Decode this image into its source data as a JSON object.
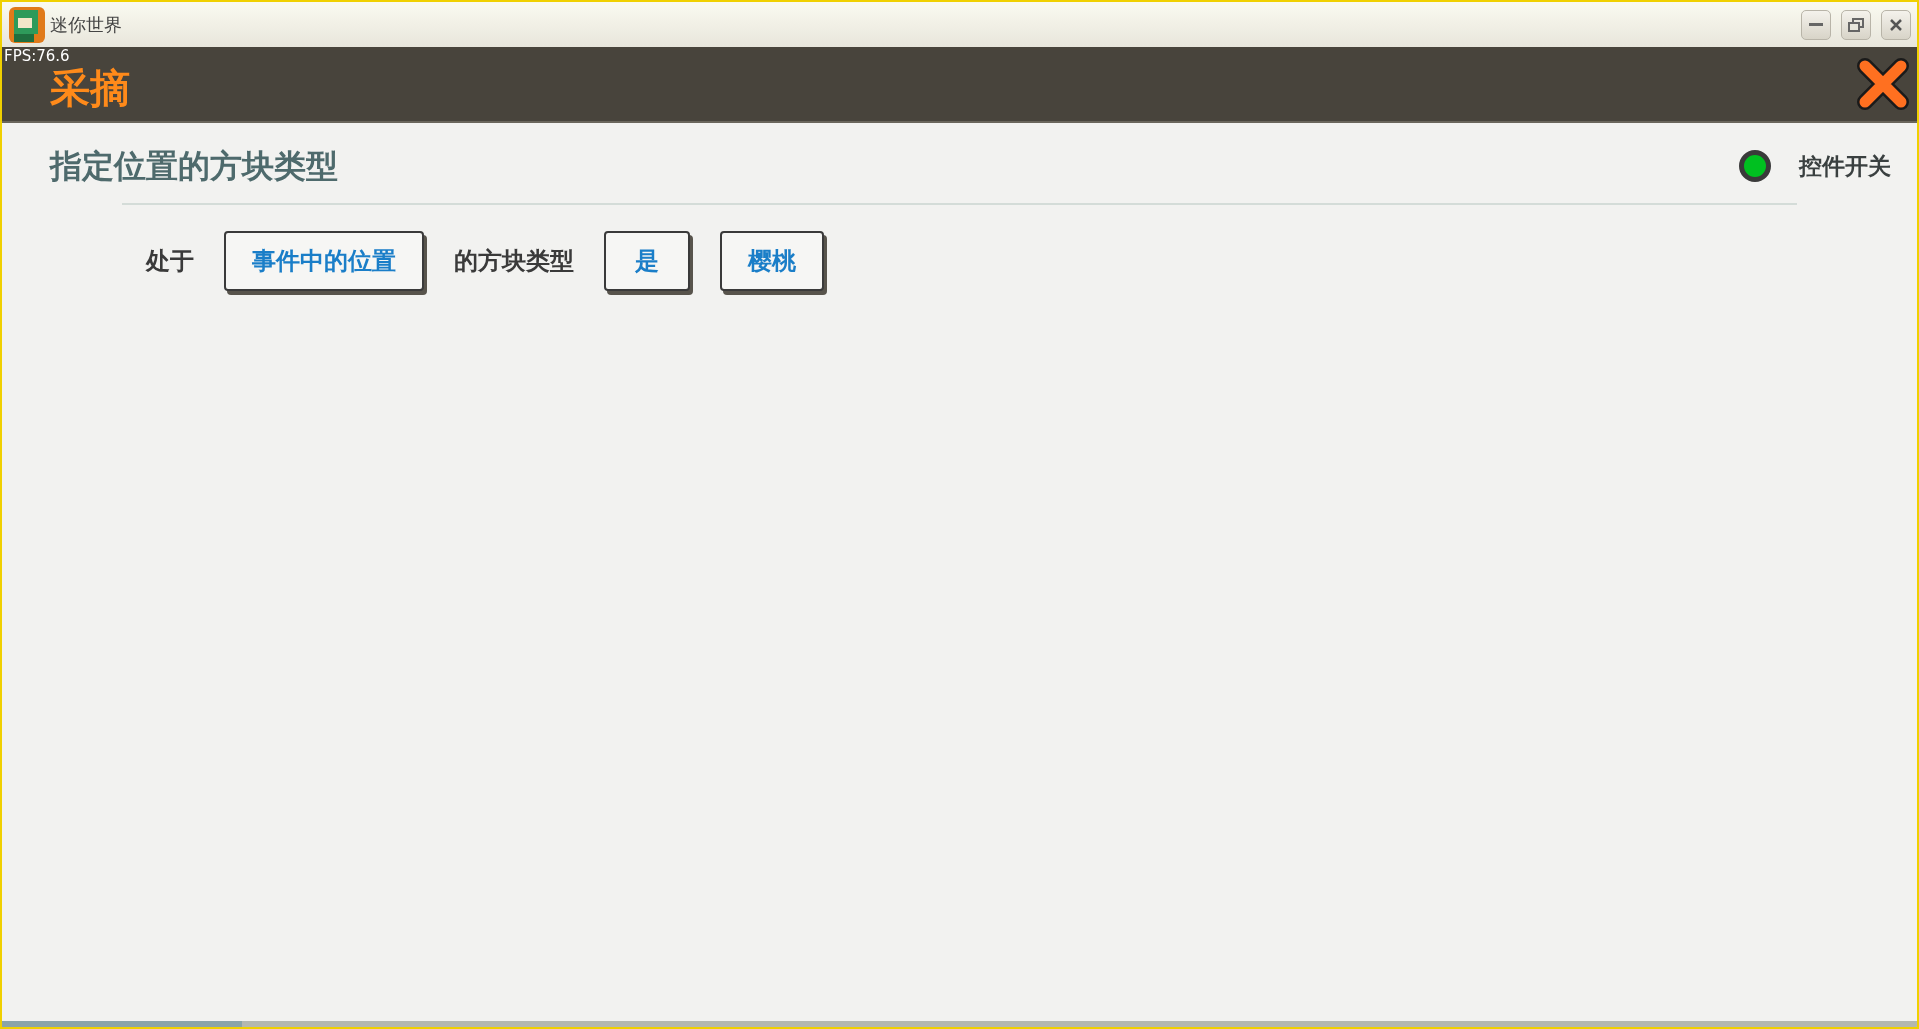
{
  "window": {
    "title": "迷你世界"
  },
  "overlay": {
    "fps": "FPS:76.6"
  },
  "header": {
    "title": "采摘"
  },
  "panel": {
    "title": "指定位置的方块类型",
    "switch": {
      "label": "控件开关",
      "on": true
    }
  },
  "condition": [
    {
      "kind": "text",
      "text": "处于"
    },
    {
      "kind": "button",
      "text": "事件中的位置"
    },
    {
      "kind": "text",
      "text": "的方块类型"
    },
    {
      "kind": "button",
      "text": "是"
    },
    {
      "kind": "button",
      "text": "樱桃"
    }
  ]
}
